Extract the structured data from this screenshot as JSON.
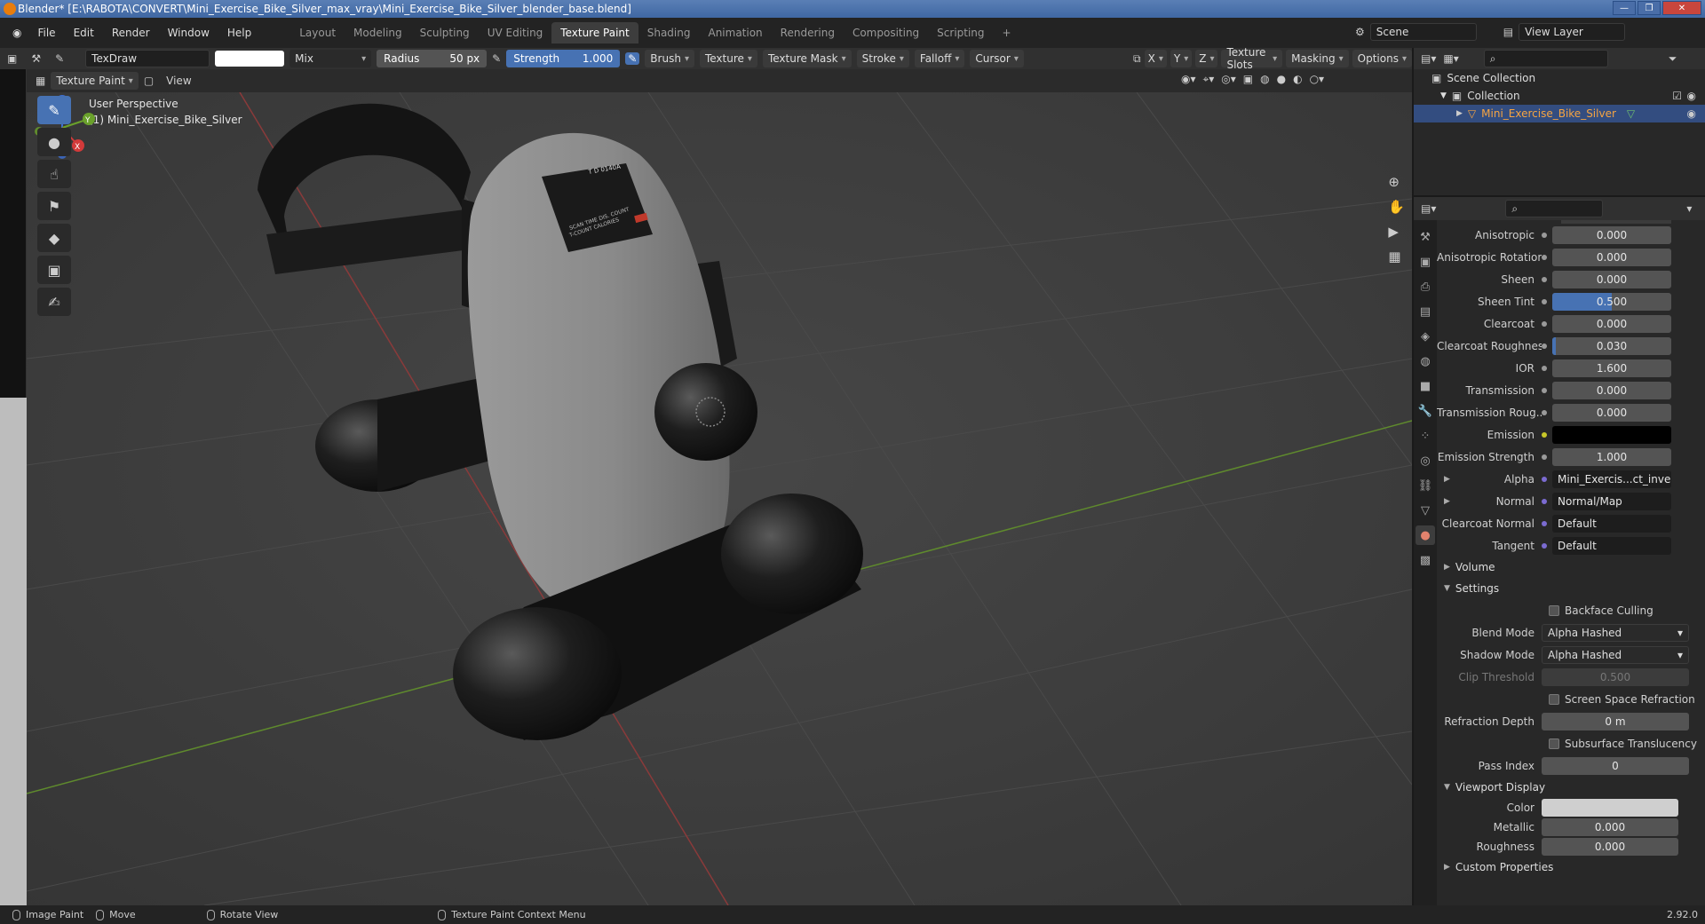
{
  "window": {
    "title": "Blender* [E:\\RABOTA\\CONVERT\\Mini_Exercise_Bike_Silver_max_vray\\Mini_Exercise_Bike_Silver_blender_base.blend]"
  },
  "menu": [
    "File",
    "Edit",
    "Render",
    "Window",
    "Help"
  ],
  "workspaces": [
    "Layout",
    "Modeling",
    "Sculpting",
    "UV Editing",
    "Texture Paint",
    "Shading",
    "Animation",
    "Rendering",
    "Compositing",
    "Scripting"
  ],
  "active_workspace": "Texture Paint",
  "scene": {
    "label": "Scene",
    "view_layer": "View Layer"
  },
  "tool_header": {
    "brush_name": "TexDraw",
    "blend": "Mix",
    "radius_label": "Radius",
    "radius_value": "50 px",
    "strength_label": "Strength",
    "strength_value": "1.000",
    "menus": [
      "Brush",
      "Texture",
      "Texture Mask",
      "Stroke",
      "Falloff",
      "Cursor"
    ],
    "axes": [
      "X",
      "Y",
      "Z"
    ],
    "right_menus": [
      "Texture Slots",
      "Masking",
      "Options"
    ]
  },
  "viewport_header": {
    "mode": "Texture Paint",
    "view": "View"
  },
  "viewport": {
    "perspective": "User Perspective",
    "object": "(1) Mini_Exercise_Bike_Silver",
    "screen_text_1": "SCAN TIME DIS. COUNT",
    "screen_text_2": "T-COUNT CALORIES",
    "display_logo": "T D 0140A"
  },
  "outliner": {
    "scene_collection": "Scene Collection",
    "collection": "Collection",
    "object": "Mini_Exercise_Bike_Silver"
  },
  "properties": {
    "rows": [
      {
        "label": "Anisotropic",
        "value": "0.000",
        "fill": 0
      },
      {
        "label": "Anisotropic Rotation",
        "value": "0.000",
        "fill": 0
      },
      {
        "label": "Sheen",
        "value": "0.000",
        "fill": 0
      },
      {
        "label": "Sheen Tint",
        "value": "0.500",
        "fill": 0.5
      },
      {
        "label": "Clearcoat",
        "value": "0.000",
        "fill": 0
      },
      {
        "label": "Clearcoat Roughnes",
        "value": "0.030",
        "fill": 0.03
      },
      {
        "label": "IOR",
        "value": "1.600",
        "fill": 0
      },
      {
        "label": "Transmission",
        "value": "0.000",
        "fill": 0
      },
      {
        "label": "Transmission Roug...",
        "value": "0.000",
        "fill": 0
      },
      {
        "label": "Emission",
        "value": "",
        "fill": 0
      },
      {
        "label": "Emission Strength",
        "value": "1.000",
        "fill": 0
      }
    ],
    "links": [
      {
        "label": "Alpha",
        "value": "Mini_Exercis...ct_invert.png"
      },
      {
        "label": "Normal",
        "value": "Normal/Map"
      },
      {
        "label": "Clearcoat Normal",
        "value": "Default"
      },
      {
        "label": "Tangent",
        "value": "Default"
      }
    ],
    "volume": "Volume",
    "settings": "Settings",
    "backface": "Backface Culling",
    "blend_mode_label": "Blend Mode",
    "blend_mode": "Alpha Hashed",
    "shadow_mode_label": "Shadow Mode",
    "shadow_mode": "Alpha Hashed",
    "clip_label": "Clip Threshold",
    "clip": "0.500",
    "ssr": "Screen Space Refraction",
    "refr_label": "Refraction Depth",
    "refr": "0 m",
    "sss": "Subsurface Translucency",
    "pass_label": "Pass Index",
    "pass": "0",
    "viewport_display": "Viewport Display",
    "color_label": "Color",
    "metallic_label": "Metallic",
    "metallic": "0.000",
    "roughness_label": "Roughness",
    "roughness": "0.000",
    "custom": "Custom Properties"
  },
  "status": {
    "image_paint": "Image Paint",
    "move": "Move",
    "rotate": "Rotate View",
    "context": "Texture Paint Context Menu",
    "version": "2.92.0"
  },
  "colors": {
    "accent": "#4772b3",
    "selected_text": "#f5a442",
    "viewport_bg": "#3d3d3d"
  }
}
